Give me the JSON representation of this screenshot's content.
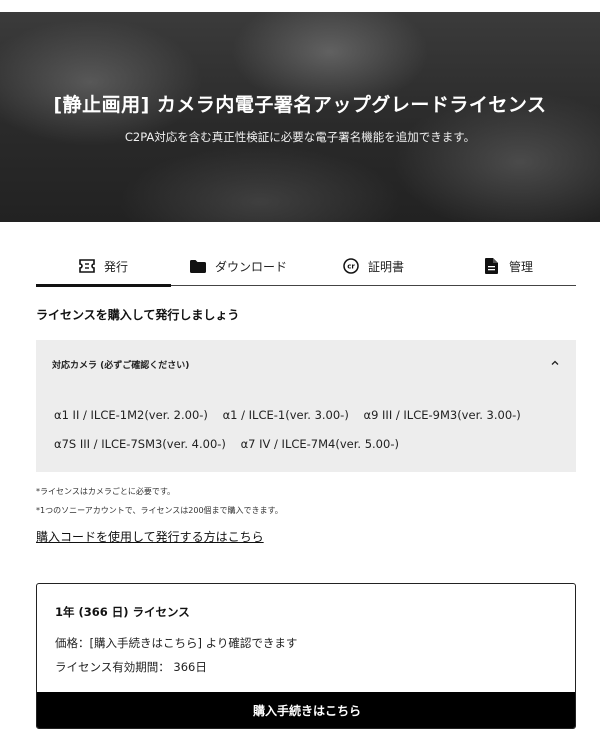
{
  "hero": {
    "title": "[静止画用] カメラ内電子署名アップグレードライセンス",
    "subtitle": "C2PA対応を含む真正性検証に必要な電子署名機能を追加できます。"
  },
  "tabs": [
    {
      "label": "発行",
      "icon": "ticket-icon",
      "active": true
    },
    {
      "label": "ダウンロード",
      "icon": "folder-icon",
      "active": false
    },
    {
      "label": "証明書",
      "icon": "cr-badge-icon",
      "active": false
    },
    {
      "label": "管理",
      "icon": "document-icon",
      "active": false
    }
  ],
  "section_title": "ライセンスを購入して発行しましょう",
  "cameras": {
    "heading": "対応カメラ (必ずご確認ください)",
    "line1": [
      "α1 II / ILCE-1M2(ver. 2.00-)",
      "α1 / ILCE-1(ver. 3.00-)",
      "α9 III / ILCE-9M3(ver. 3.00-)"
    ],
    "line2": [
      "α7S III / ILCE-7SM3(ver. 4.00-)",
      "α7 IV / ILCE-7M4(ver. 5.00-)"
    ]
  },
  "notes": [
    "*ライセンスはカメラごとに必要です。",
    "*1つのソニーアカウントで、ライセンスは200個まで購入できます。"
  ],
  "purchase_code_link": "購入コードを使用して発行する方はこちら",
  "license": {
    "title": "1年 (366 日) ライセンス",
    "price": "価格：[購入手続きはこちら] より確認できます",
    "period": "ライセンス有効期間： 366日",
    "button": "購入手続きはこちら"
  }
}
